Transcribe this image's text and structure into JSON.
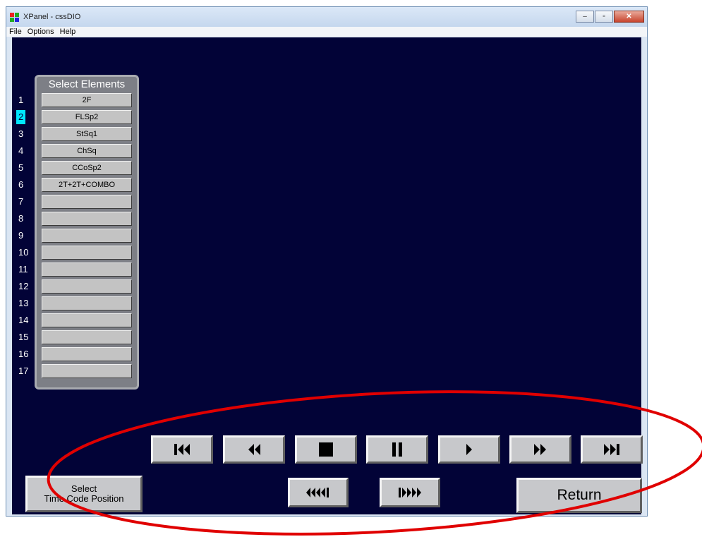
{
  "window": {
    "title": "XPanel - cssDIO",
    "controls": {
      "minimize": "–",
      "maximize": "▫",
      "close": "✕"
    }
  },
  "menu": [
    "File",
    "Options",
    "Help"
  ],
  "panel": {
    "title": "Select Elements",
    "selected_row": 2,
    "rows": [
      {
        "num": "1",
        "label": "2F"
      },
      {
        "num": "2",
        "label": "FLSp2"
      },
      {
        "num": "3",
        "label": "StSq1"
      },
      {
        "num": "4",
        "label": "ChSq"
      },
      {
        "num": "5",
        "label": "CCoSp2"
      },
      {
        "num": "6",
        "label": "2T+2T+COMBO"
      },
      {
        "num": "7",
        "label": ""
      },
      {
        "num": "8",
        "label": ""
      },
      {
        "num": "9",
        "label": ""
      },
      {
        "num": "10",
        "label": ""
      },
      {
        "num": "11",
        "label": ""
      },
      {
        "num": "12",
        "label": ""
      },
      {
        "num": "13",
        "label": ""
      },
      {
        "num": "14",
        "label": ""
      },
      {
        "num": "15",
        "label": ""
      },
      {
        "num": "16",
        "label": ""
      },
      {
        "num": "17",
        "label": ""
      }
    ]
  },
  "transport": {
    "icons": [
      "skip-to-start-icon",
      "rewind-icon",
      "stop-icon",
      "pause-icon",
      "play-icon",
      "fast-forward-icon",
      "skip-to-end-icon"
    ],
    "secondary_icons": [
      "fast-rewind-multi-icon",
      "fast-forward-multi-icon"
    ]
  },
  "buttons": {
    "timecode_line1": "Select",
    "timecode_line2": "Time Code Position",
    "return": "Return"
  },
  "colors": {
    "background": "#020337",
    "selected_row": "#00e7ff",
    "annotation": "#e00000"
  }
}
